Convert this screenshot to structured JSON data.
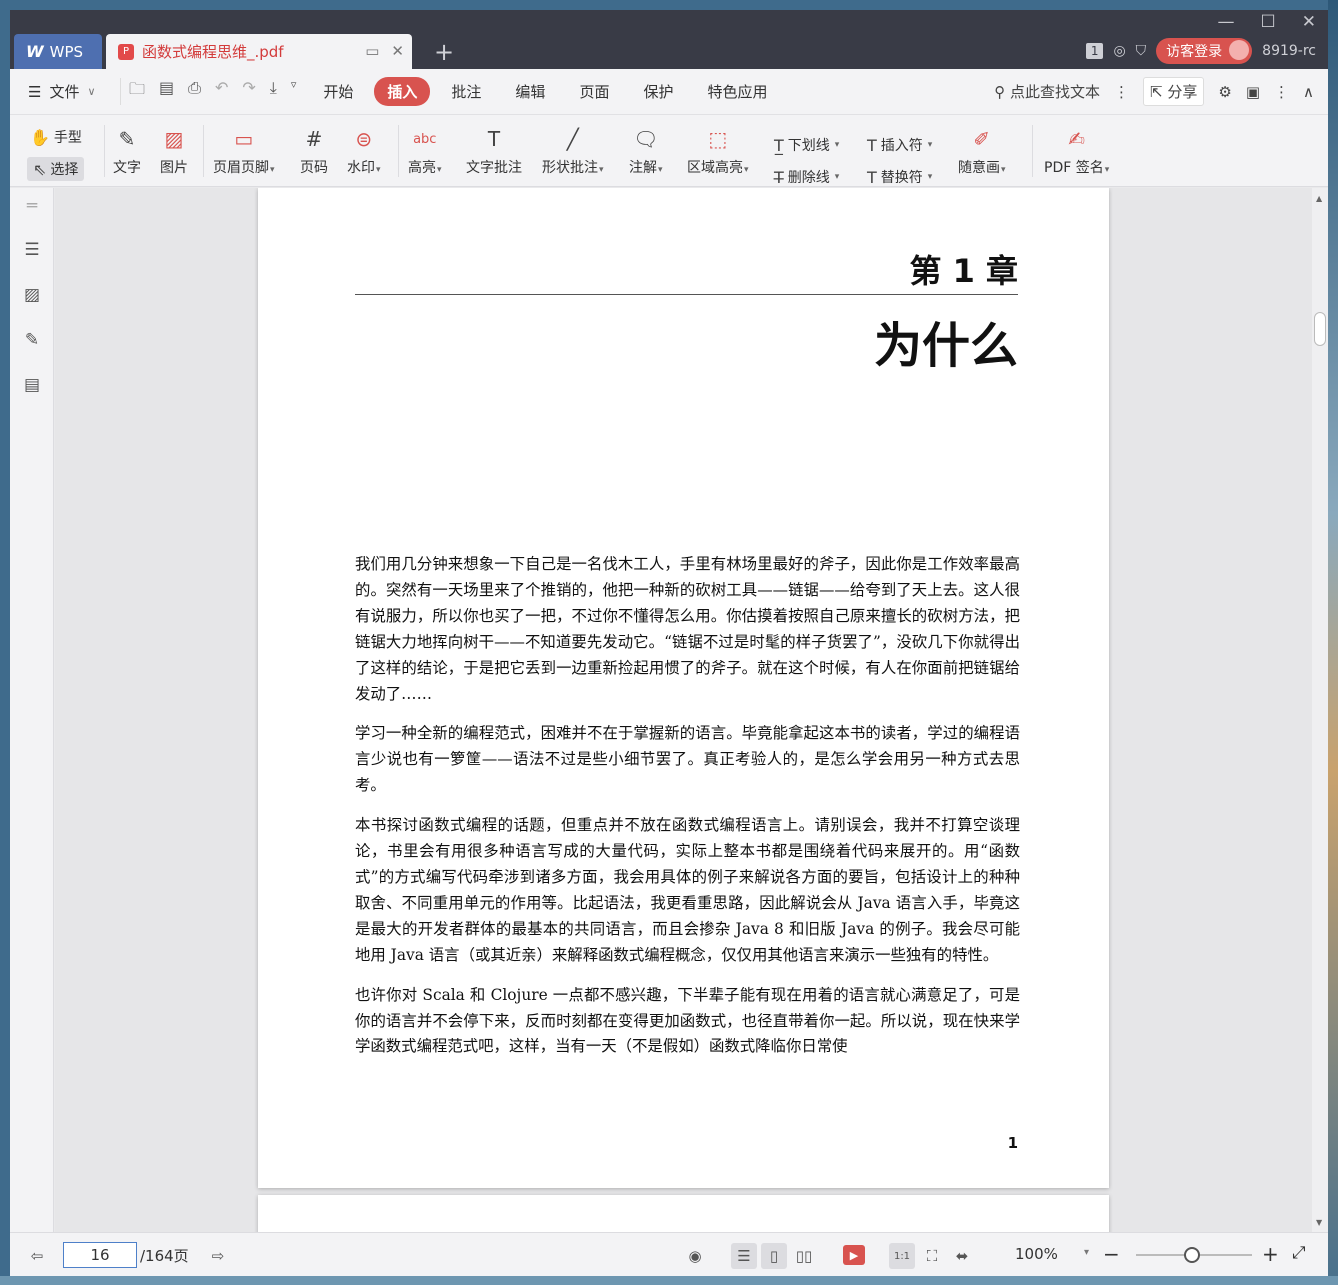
{
  "tabs": {
    "app_label": "WPS",
    "doc_label": "函数式编程思维_.pdf"
  },
  "title_bar": {
    "page_badge": "1",
    "login_label": "访客登录",
    "user_id": "8919-rc"
  },
  "menu": {
    "file_label": "文件",
    "tabs": [
      "开始",
      "插入",
      "批注",
      "编辑",
      "页面",
      "保护",
      "特色应用"
    ],
    "active_tab": "插入",
    "search_label": "点此查找文本",
    "share_label": "分享"
  },
  "ribbon": {
    "hand": "手型",
    "select": "选择",
    "text": "文字",
    "image": "图片",
    "header_footer": "页眉页脚",
    "page_number": "页码",
    "watermark": "水印",
    "highlight": "高亮",
    "text_comment": "文字批注",
    "shape_comment": "形状批注",
    "annotation": "注解",
    "area_highlight": "区域高亮",
    "underline": "下划线",
    "strikethrough": "删除线",
    "insert_mark": "插入符",
    "replace_mark": "替换符",
    "freehand": "随意画",
    "pdf_sign": "PDF 签名"
  },
  "document": {
    "chapter_number": "第 1 章",
    "chapter_title": "为什么",
    "paragraphs": [
      "我们用几分钟来想象一下自己是一名伐木工人，手里有林场里最好的斧子，因此你是工作效率最高的。突然有一天场里来了个推销的，他把一种新的砍树工具——链锯——给夸到了天上去。这人很有说服力，所以你也买了一把，不过你不懂得怎么用。你估摸着按照自己原来擅长的砍树方法，把链锯大力地挥向树干——不知道要先发动它。“链锯不过是时髦的样子货罢了”，没砍几下你就得出了这样的结论，于是把它丢到一边重新捡起用惯了的斧子。就在这个时候，有人在你面前把链锯给发动了……",
      "学习一种全新的编程范式，困难并不在于掌握新的语言。毕竟能拿起这本书的读者，学过的编程语言少说也有一箩筐——语法不过是些小细节罢了。真正考验人的，是怎么学会用另一种方式去思考。",
      "本书探讨函数式编程的话题，但重点并不放在函数式编程语言上。请别误会，我并不打算空谈理论，书里会有用很多种语言写成的大量代码，实际上整本书都是围绕着代码来展开的。用“函数式”的方式编写代码牵涉到诸多方面，我会用具体的例子来解说各方面的要旨，包括设计上的种种取舍、不同重用单元的作用等。比起语法，我更看重思路，因此解说会从 Java 语言入手，毕竟这是最大的开发者群体的最基本的共同语言，而且会掺杂 Java 8 和旧版 Java 的例子。我会尽可能地用 Java 语言（或其近亲）来解释函数式编程概念，仅仅用其他语言来演示一些独有的特性。",
      "也许你对 Scala 和 Clojure 一点都不感兴趣，下半辈子能有现在用着的语言就心满意足了，可是你的语言并不会停下来，反而时刻都在变得更加函数式，也径直带着你一起。所以说，现在快来学学函数式编程范式吧，这样，当有一天（不是假如）函数式降临你日常使"
    ],
    "page_footer_number": "1"
  },
  "status": {
    "current_page": "16",
    "total_pages": "/164页",
    "zoom": "100%"
  }
}
